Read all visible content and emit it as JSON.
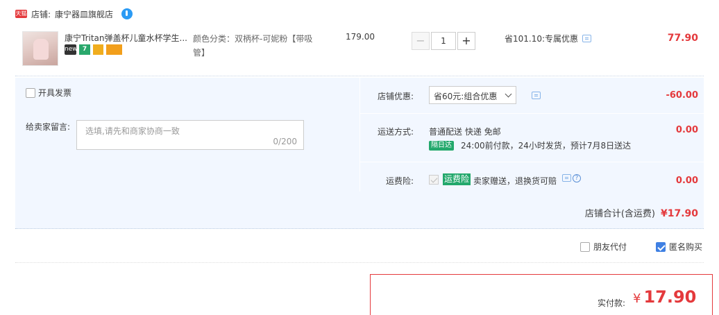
{
  "shop": {
    "badge": "天猫",
    "prefix": "店铺:",
    "name": "康宁器皿旗舰店"
  },
  "item": {
    "title": "康宁Tritan弹盖杯儿童水杯学生...",
    "badges": [
      "new",
      "7",
      "",
      ""
    ],
    "spec": "颜色分类：双柄杯-可妮粉【带吸管】",
    "price": "179.00",
    "qty_minus": "−",
    "qty": "1",
    "qty_plus": "+",
    "promo": "省101.10:专属优惠",
    "total": "77.90"
  },
  "options": {
    "invoice_label": "开具发票",
    "message_label": "给卖家留言:",
    "message_placeholder": "选填,请先和商家协商一致",
    "message_count": "0/200",
    "store_discount_label": "店铺优惠:",
    "store_discount_value": "省60元:组合优惠",
    "store_discount_amount": "-60.00",
    "shipping_label": "运送方式:",
    "shipping_method": "普通配送 快递 免邮",
    "shipping_tag": "隔日达",
    "shipping_note": "24:00前付款，24小时发货，预计7月8日送达",
    "shipping_amount": "0.00",
    "insurance_label": "运费险:",
    "insurance_tag": "运费险",
    "insurance_text": "卖家赠送，退换货可赔",
    "insurance_amount": "0.00",
    "help_glyph": "?",
    "store_total_label": "店铺合计(含运费)",
    "store_total_amount": "¥17.90"
  },
  "bottom": {
    "friend_pay_label": "朋友代付",
    "anonymous_label": "匿名购买",
    "pay_label": "实付款:",
    "pay_currency": "¥",
    "pay_amount": "17.90"
  }
}
